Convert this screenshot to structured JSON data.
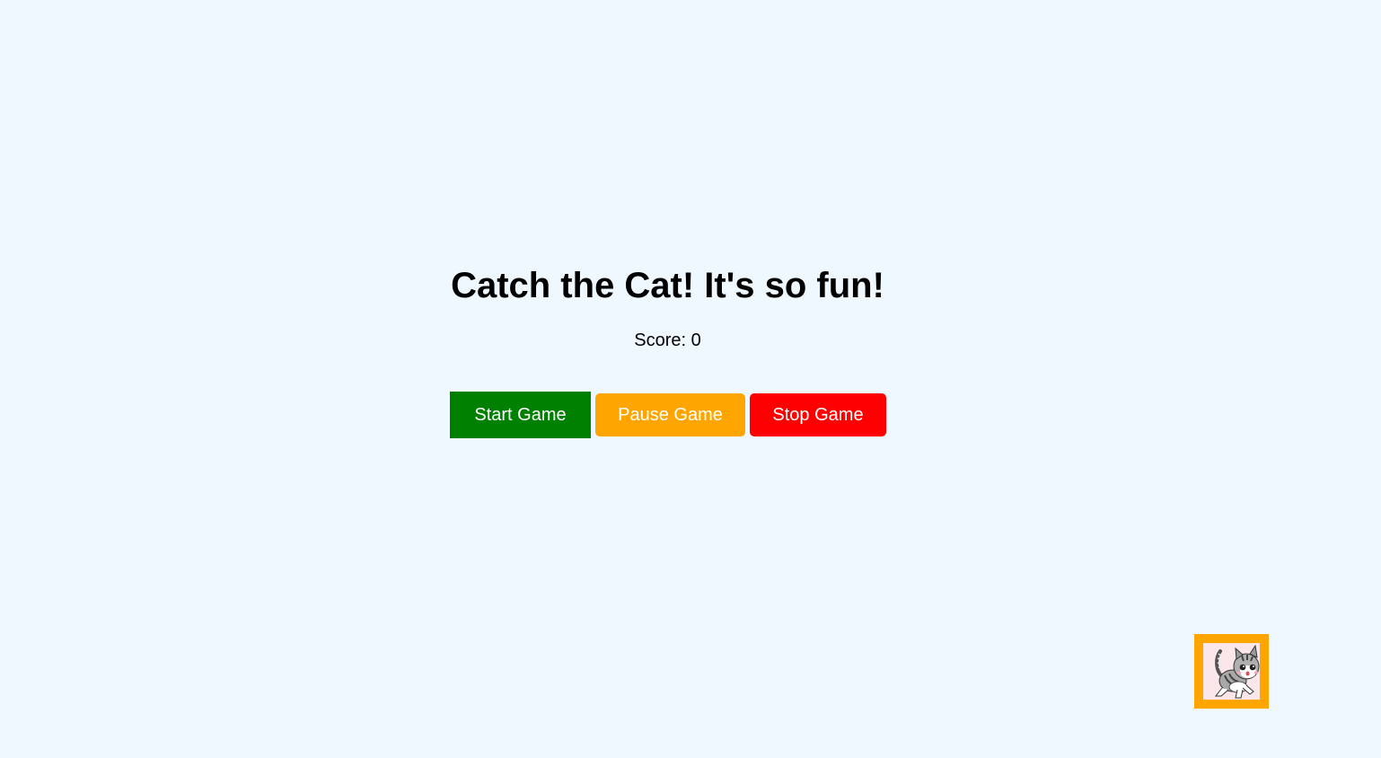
{
  "game": {
    "title": "Catch the Cat! It's so fun!",
    "score_label": "Score: 0",
    "score_value": 0
  },
  "controls": {
    "start_label": "Start Game",
    "pause_label": "Pause Game",
    "stop_label": "Stop Game"
  },
  "cat": {
    "icon": "cat-icon",
    "border_color": "#ffa500"
  },
  "colors": {
    "background": "#eff7ff",
    "start": "#008000",
    "pause": "#ffa500",
    "stop": "#ff0000"
  }
}
